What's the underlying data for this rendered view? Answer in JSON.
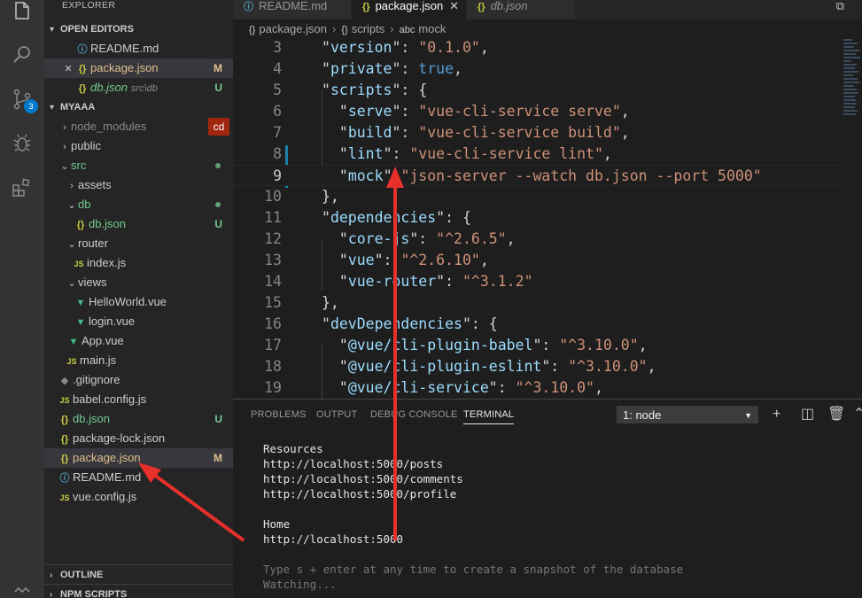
{
  "sidebar": {
    "title": "EXPLORER",
    "open_editors": {
      "header": "OPEN EDITORS",
      "items": [
        {
          "label": "README.md",
          "icon": "info-icon",
          "desc": "",
          "badge": ""
        },
        {
          "label": "package.json",
          "icon": "json-braces-icon",
          "desc": "",
          "badge": "M"
        },
        {
          "label": "db.json",
          "icon": "json-braces-icon",
          "desc": "src\\db",
          "badge": "U"
        }
      ]
    },
    "project": {
      "header": "MYAAA",
      "items": [
        {
          "label": "node_modules",
          "badge": "cd"
        },
        {
          "label": "public",
          "badge": ""
        },
        {
          "label": "src",
          "badge": ""
        },
        {
          "label": "assets",
          "badge": ""
        },
        {
          "label": "db",
          "badge": ""
        },
        {
          "label": "db.json",
          "badge": "U"
        },
        {
          "label": "router",
          "badge": ""
        },
        {
          "label": "index.js",
          "badge": ""
        },
        {
          "label": "views",
          "badge": ""
        },
        {
          "label": "HelloWorld.vue",
          "badge": ""
        },
        {
          "label": "login.vue",
          "badge": ""
        },
        {
          "label": "App.vue",
          "badge": ""
        },
        {
          "label": "main.js",
          "badge": ""
        },
        {
          "label": ".gitignore",
          "badge": ""
        },
        {
          "label": "babel.config.js",
          "badge": ""
        },
        {
          "label": "db.json",
          "badge": "U"
        },
        {
          "label": "package-lock.json",
          "badge": ""
        },
        {
          "label": "package.json",
          "badge": "M"
        },
        {
          "label": "README.md",
          "badge": ""
        },
        {
          "label": "vue.config.js",
          "badge": ""
        }
      ]
    },
    "outline": "OUTLINE",
    "npm_scripts": "NPM SCRIPTS"
  },
  "activity": {
    "scm_badge": "3",
    "icons": [
      "files-icon",
      "search-icon",
      "source-control-icon",
      "debug-icon",
      "extensions-icon",
      "remote-icon"
    ]
  },
  "tabs": [
    {
      "label": "README.md",
      "icon": "info-icon",
      "active": false
    },
    {
      "label": "package.json",
      "icon": "json-braces-icon",
      "active": true
    },
    {
      "label": "db.json",
      "icon": "json-braces-icon",
      "active": false
    }
  ],
  "breadcrumb": {
    "file": "package.json",
    "scope": "scripts",
    "symbol": "mock"
  },
  "editor": {
    "lines": [
      {
        "n": "3",
        "key": "version",
        "val": "\"0.1.0\"",
        "tail": ","
      },
      {
        "n": "4",
        "key": "private",
        "val": "true",
        "tail": ","
      },
      {
        "n": "5",
        "key": "scripts",
        "val": "",
        "tail": "{"
      },
      {
        "n": "6",
        "key": "serve",
        "val": "\"vue-cli-service serve\"",
        "tail": ","
      },
      {
        "n": "7",
        "key": "build",
        "val": "\"vue-cli-service build\"",
        "tail": ","
      },
      {
        "n": "8",
        "key": "lint",
        "val": "\"vue-cli-service lint\"",
        "tail": ","
      },
      {
        "n": "9",
        "key": "mock",
        "val": "\"json-server --watch db.json --port 5000\"",
        "tail": ""
      },
      {
        "n": "10",
        "key": "",
        "val": "",
        "tail": "},"
      },
      {
        "n": "11",
        "key": "dependencies",
        "val": "",
        "tail": "{"
      },
      {
        "n": "12",
        "key": "core-js",
        "val": "\"^2.6.5\"",
        "tail": ","
      },
      {
        "n": "13",
        "key": "vue",
        "val": "\"^2.6.10\"",
        "tail": ","
      },
      {
        "n": "14",
        "key": "vue-router",
        "val": "\"^3.1.2\"",
        "tail": ""
      },
      {
        "n": "15",
        "key": "",
        "val": "",
        "tail": "},"
      },
      {
        "n": "16",
        "key": "devDependencies",
        "val": "",
        "tail": "{"
      },
      {
        "n": "17",
        "key": "@vue/cli-plugin-babel",
        "val": "\"^3.10.0\"",
        "tail": ","
      },
      {
        "n": "18",
        "key": "@vue/cli-plugin-eslint",
        "val": "\"^3.10.0\"",
        "tail": ","
      },
      {
        "n": "19",
        "key": "@vue/cli-service",
        "val": "\"^3.10.0\"",
        "tail": ","
      }
    ]
  },
  "panel": {
    "tabs": [
      "PROBLEMS",
      "OUTPUT",
      "DEBUG CONSOLE",
      "TERMINAL"
    ],
    "active_tab": "TERMINAL",
    "terminal_select": "1: node",
    "terminal_lines": [
      "Resources",
      "http://localhost:5000/posts",
      "http://localhost:5000/comments",
      "http://localhost:5000/profile",
      "",
      "Home",
      "http://localhost:5000",
      "",
      "Type s + enter at any time to create a snapshot of the database",
      "Watching..."
    ]
  },
  "colors": {
    "accent": "#007acc",
    "annotation_arrow": "#e8302a",
    "modified": "#e2c08d",
    "untracked": "#73c991"
  }
}
